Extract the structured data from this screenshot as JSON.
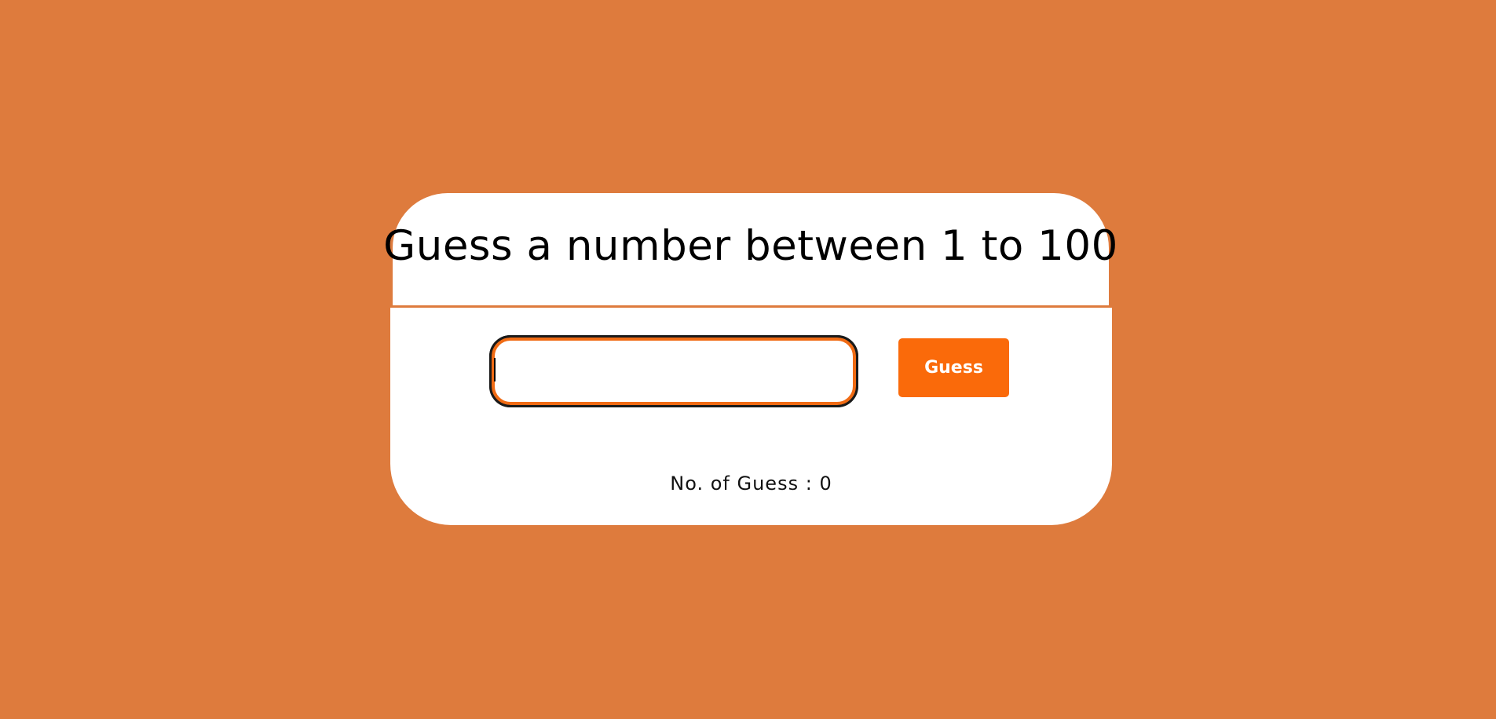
{
  "header": {
    "title": "Guess a number between 1 to 100"
  },
  "form": {
    "input_value": "",
    "input_placeholder": "",
    "guess_label": "Guess"
  },
  "status": {
    "count_label": "No. of Guess : ",
    "count_value": "0"
  },
  "colors": {
    "background": "#de7b3d",
    "accent": "#fa6a0a",
    "card": "#ffffff"
  }
}
